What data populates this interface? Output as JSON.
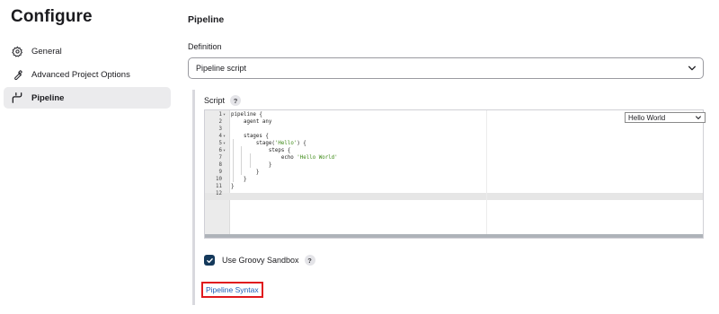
{
  "sidebar": {
    "title": "Configure",
    "items": [
      {
        "label": "General",
        "icon": "gear-icon"
      },
      {
        "label": "Advanced Project Options",
        "icon": "wrench-icon"
      },
      {
        "label": "Pipeline",
        "icon": "pipeline-icon",
        "active": true
      }
    ]
  },
  "main": {
    "section_title": "Pipeline",
    "definition_label": "Definition",
    "definition_value": "Pipeline script",
    "script_label": "Script",
    "help_glyph": "?",
    "sample_select_value": "Hello World",
    "code": [
      {
        "n": "1",
        "fold": "▾",
        "text": "pipeline {"
      },
      {
        "n": "2",
        "fold": "",
        "text": "    agent any"
      },
      {
        "n": "3",
        "fold": "",
        "text": ""
      },
      {
        "n": "4",
        "fold": "▾",
        "text": "    stages {"
      },
      {
        "n": "5",
        "fold": "▾",
        "text": "        stage('Hello') {"
      },
      {
        "n": "6",
        "fold": "▾",
        "text": "            steps {"
      },
      {
        "n": "7",
        "fold": "",
        "text": "                echo 'Hello World'"
      },
      {
        "n": "8",
        "fold": "",
        "text": "            }"
      },
      {
        "n": "9",
        "fold": "",
        "text": "        }"
      },
      {
        "n": "10",
        "fold": "",
        "text": "    }"
      },
      {
        "n": "11",
        "fold": "",
        "text": "}"
      },
      {
        "n": "12",
        "fold": "",
        "text": ""
      }
    ],
    "sandbox_label": "Use Groovy Sandbox",
    "sandbox_checked": true,
    "syntax_link": "Pipeline Syntax"
  },
  "colors": {
    "checkbox": "#14395b",
    "link": "#1f5fb8",
    "highlight_border": "#e0191e",
    "string": "#3d8a16",
    "active_item_bg": "#ebebed"
  }
}
